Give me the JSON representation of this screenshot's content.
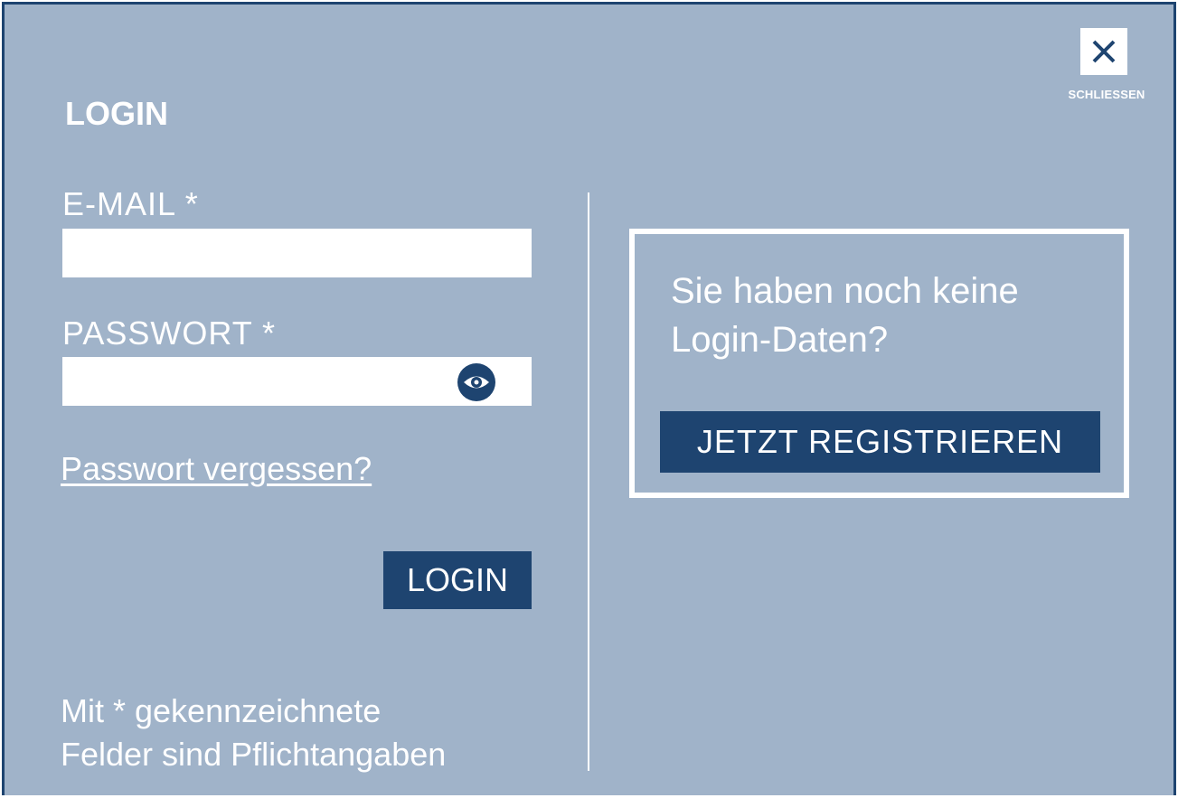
{
  "dialog": {
    "title": "LOGIN",
    "close_label": "SCHLIESSEN",
    "close_icon": "close-icon"
  },
  "form": {
    "email_label": "E-MAIL *",
    "email_value": "",
    "password_label": "PASSWORT *",
    "password_value": "",
    "password_toggle_icon": "eye-icon",
    "forgot_link": "Passwort vergessen?",
    "login_button": "LOGIN",
    "required_hint_line1": "Mit * gekennzeichnete",
    "required_hint_line2": "Felder sind Pflichtangaben"
  },
  "register": {
    "text_line1": "Sie haben noch keine",
    "text_line2": "Login-Daten?",
    "button": "JETZT REGISTRIEREN"
  },
  "colors": {
    "background": "#a0b3c9",
    "primary": "#1e4470",
    "text": "#ffffff"
  }
}
